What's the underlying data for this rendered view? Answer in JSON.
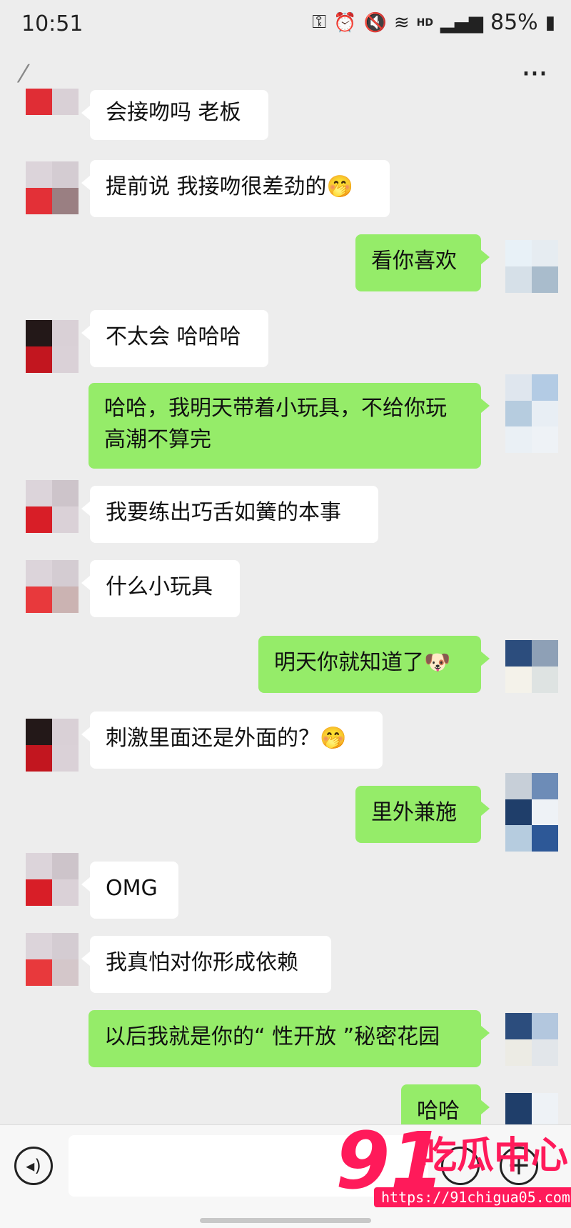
{
  "status_bar": {
    "time": "10:51",
    "battery": "85%",
    "icons": [
      "key-icon",
      "alarm-icon",
      "mute-icon",
      "wifi-icon",
      "hd-icon",
      "signal-icon",
      "battery-icon"
    ],
    "hd_label": "HD"
  },
  "nav": {
    "title": "",
    "more_label": "···"
  },
  "messages": [
    {
      "side": "in",
      "text": "会接吻吗 老板"
    },
    {
      "side": "in",
      "text": "提前说 我接吻很差劲的🤭"
    },
    {
      "side": "out",
      "text": "看你喜欢"
    },
    {
      "side": "in",
      "text": "不太会 哈哈哈"
    },
    {
      "side": "out",
      "text": "哈哈，我明天带着小玩具，不给你玩高潮不算完"
    },
    {
      "side": "in",
      "text": "我要练出巧舌如簧的本事"
    },
    {
      "side": "in",
      "text": "什么小玩具"
    },
    {
      "side": "out",
      "text": "明天你就知道了🐶"
    },
    {
      "side": "in",
      "text": "刺激里面还是外面的？🤭"
    },
    {
      "side": "out",
      "text": "里外兼施"
    },
    {
      "side": "in",
      "text": "OMG"
    },
    {
      "side": "in",
      "text": "我真怕对你形成依赖"
    },
    {
      "side": "out",
      "text": "以后我就是你的“ 性开放 ”秘密花园"
    },
    {
      "side": "out",
      "text": "哈哈"
    }
  ],
  "input_bar": {
    "placeholder": "",
    "voice_icon": "voice-icon",
    "emoji_icon": "emoji-icon",
    "plus_icon": "plus-icon"
  },
  "watermark": {
    "number": "91",
    "name": "吃瓜中心",
    "url": "https://91chigua05.com"
  },
  "colors": {
    "background": "#ededed",
    "incoming_bubble": "#ffffff",
    "outgoing_bubble": "#95ec69",
    "watermark": "#ff1a5a"
  }
}
